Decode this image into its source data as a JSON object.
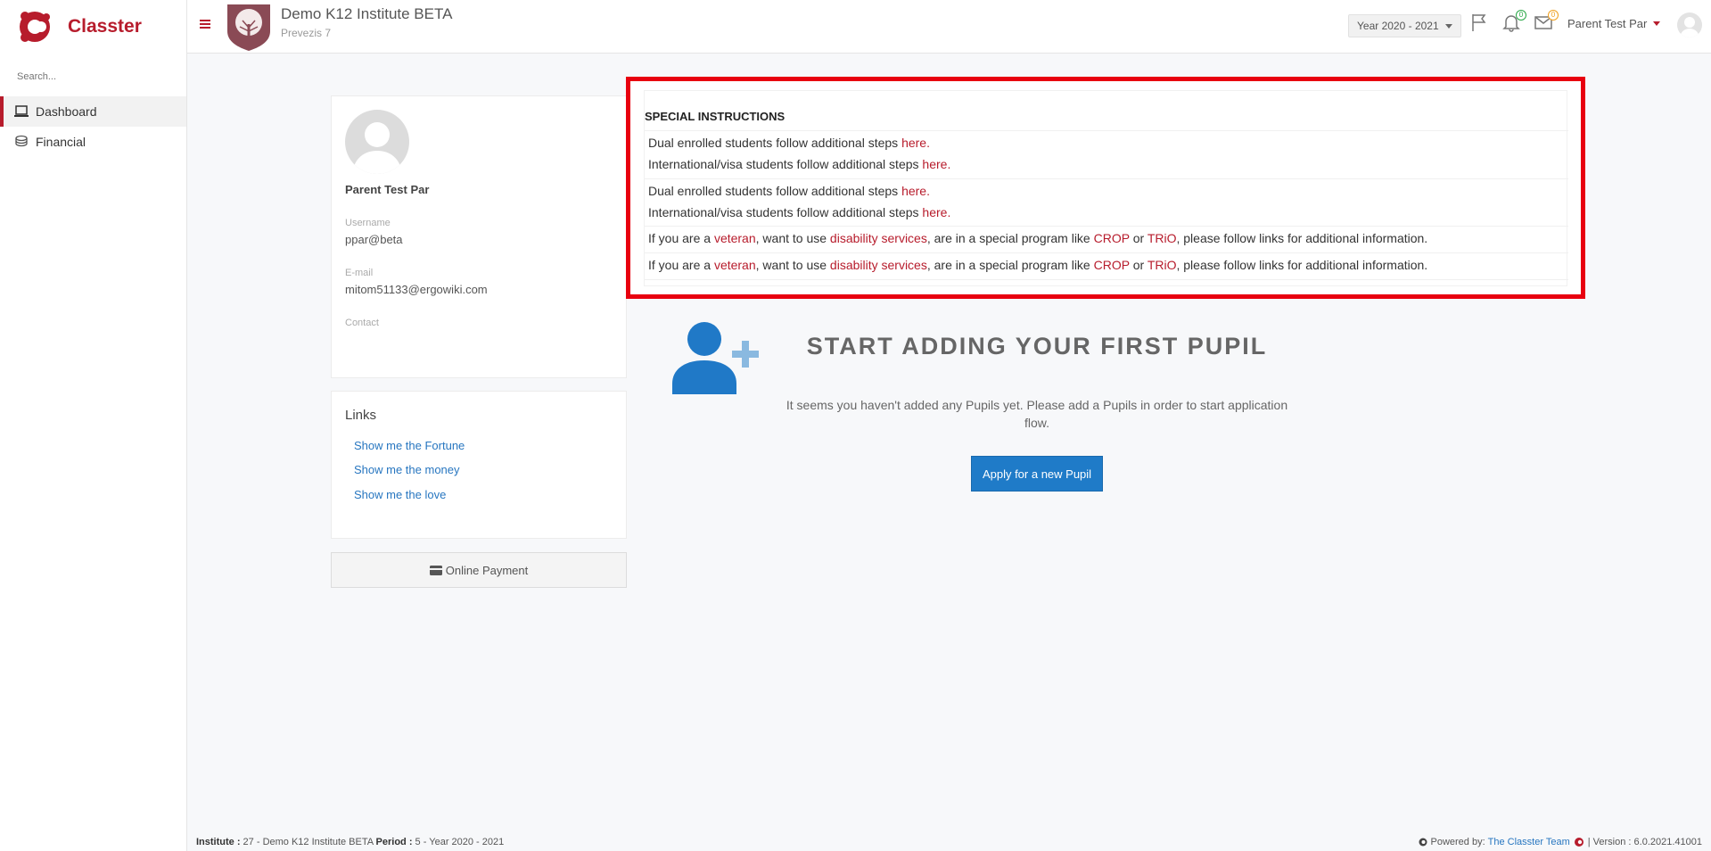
{
  "brand": {
    "name": "Classter",
    "color": "#b71c2c"
  },
  "sidebar": {
    "search_placeholder": "Search...",
    "items": [
      {
        "label": "Dashboard",
        "icon": "laptop-icon",
        "active": true
      },
      {
        "label": "Financial",
        "icon": "coins-icon",
        "active": false
      }
    ]
  },
  "header": {
    "institute_name": "Demo K12 Institute BETA",
    "institute_sub": "Prevezis 7",
    "year_selector": "Year 2020 - 2021",
    "notifications_count": "0",
    "messages_count": "0",
    "user_name": "Parent Test Par"
  },
  "profile": {
    "name": "Parent Test Par",
    "username_label": "Username",
    "username": "ppar@beta",
    "email_label": "E-mail",
    "email": "mitom51133@ergowiki.com",
    "contact_label": "Contact"
  },
  "links": {
    "title": "Links",
    "items": [
      "Show me the Fortune",
      "Show me the money",
      "Show me the love"
    ]
  },
  "payment": {
    "label": "Online Payment"
  },
  "special": {
    "title": "SPECIAL INSTRUCTIONS",
    "dual_text": "Dual enrolled students follow additional steps ",
    "intl_text": "International/visa students follow additional steps ",
    "here": "here",
    "period": ".",
    "vet_prefix": "If you are a ",
    "veteran": "veteran",
    "vet_mid1": ", want to use ",
    "disability": "disability services",
    "vet_mid2": ", are in a special program like ",
    "crop": "CROP",
    "or": " or ",
    "trio": "TRiO",
    "vet_suffix": ", please follow links for additional information."
  },
  "empty_state": {
    "title": "START ADDING YOUR FIRST PUPIL",
    "text": "It seems you haven't added any Pupils yet. Please add a Pupils in order to start application flow.",
    "button": "Apply for a new Pupil"
  },
  "footer": {
    "institute_label": "Institute :",
    "institute_value": " 27 - Demo K12 Institute BETA ",
    "period_label": "Period :",
    "period_value": " 5 - Year 2020 - 2021",
    "powered_by": "Powered by:",
    "team": "The Classter Team",
    "version": "| Version : 6.0.2021.41001"
  }
}
